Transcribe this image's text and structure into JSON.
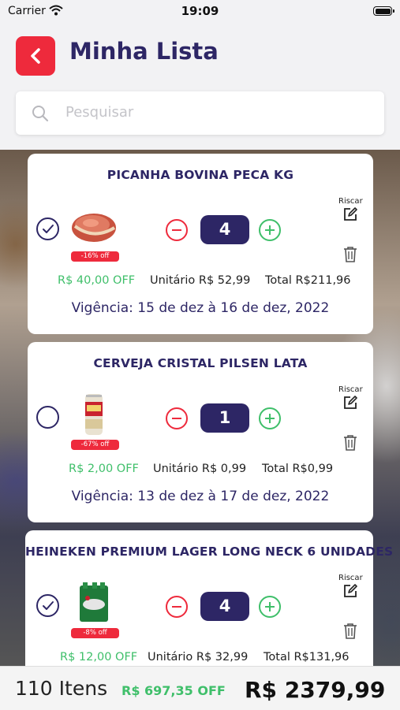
{
  "status_bar": {
    "carrier": "Carrier",
    "time": "19:09"
  },
  "header": {
    "title": "Minha Lista",
    "search_placeholder": "Pesquisar"
  },
  "items": [
    {
      "name": "PICANHA BOVINA PECA KG",
      "checked": true,
      "discount_badge": "-16% off",
      "quantity": "4",
      "riscar_label": "Riscar",
      "off": "R$ 40,00 OFF",
      "unit_price": "Unitário R$ 52,99",
      "total": "Total R$211,96",
      "validity": "Vigência: 15 de dez à 16 de dez, 2022"
    },
    {
      "name": "CERVEJA CRISTAL PILSEN LATA",
      "checked": false,
      "discount_badge": "-67% off",
      "quantity": "1",
      "riscar_label": "Riscar",
      "off": "R$ 2,00 OFF",
      "unit_price": "Unitário R$ 0,99",
      "total": "Total R$0,99",
      "validity": "Vigência: 13 de dez à 17 de dez, 2022"
    },
    {
      "name": "HEINEKEN PREMIUM LAGER LONG NECK 6 UNIDADES",
      "checked": true,
      "discount_badge": "-8% off",
      "quantity": "4",
      "riscar_label": "Riscar",
      "off": "R$ 12,00 OFF",
      "unit_price": "Unitário R$ 32,99",
      "total": "Total R$131,96",
      "validity": ""
    }
  ],
  "footer": {
    "items_count": "110 Itens",
    "total_off": "R$ 697,35 OFF",
    "grand_total": "R$ 2379,99"
  },
  "colors": {
    "primary": "#2d2665",
    "accent_red": "#ee2a3c",
    "accent_green": "#3fbf6a"
  }
}
